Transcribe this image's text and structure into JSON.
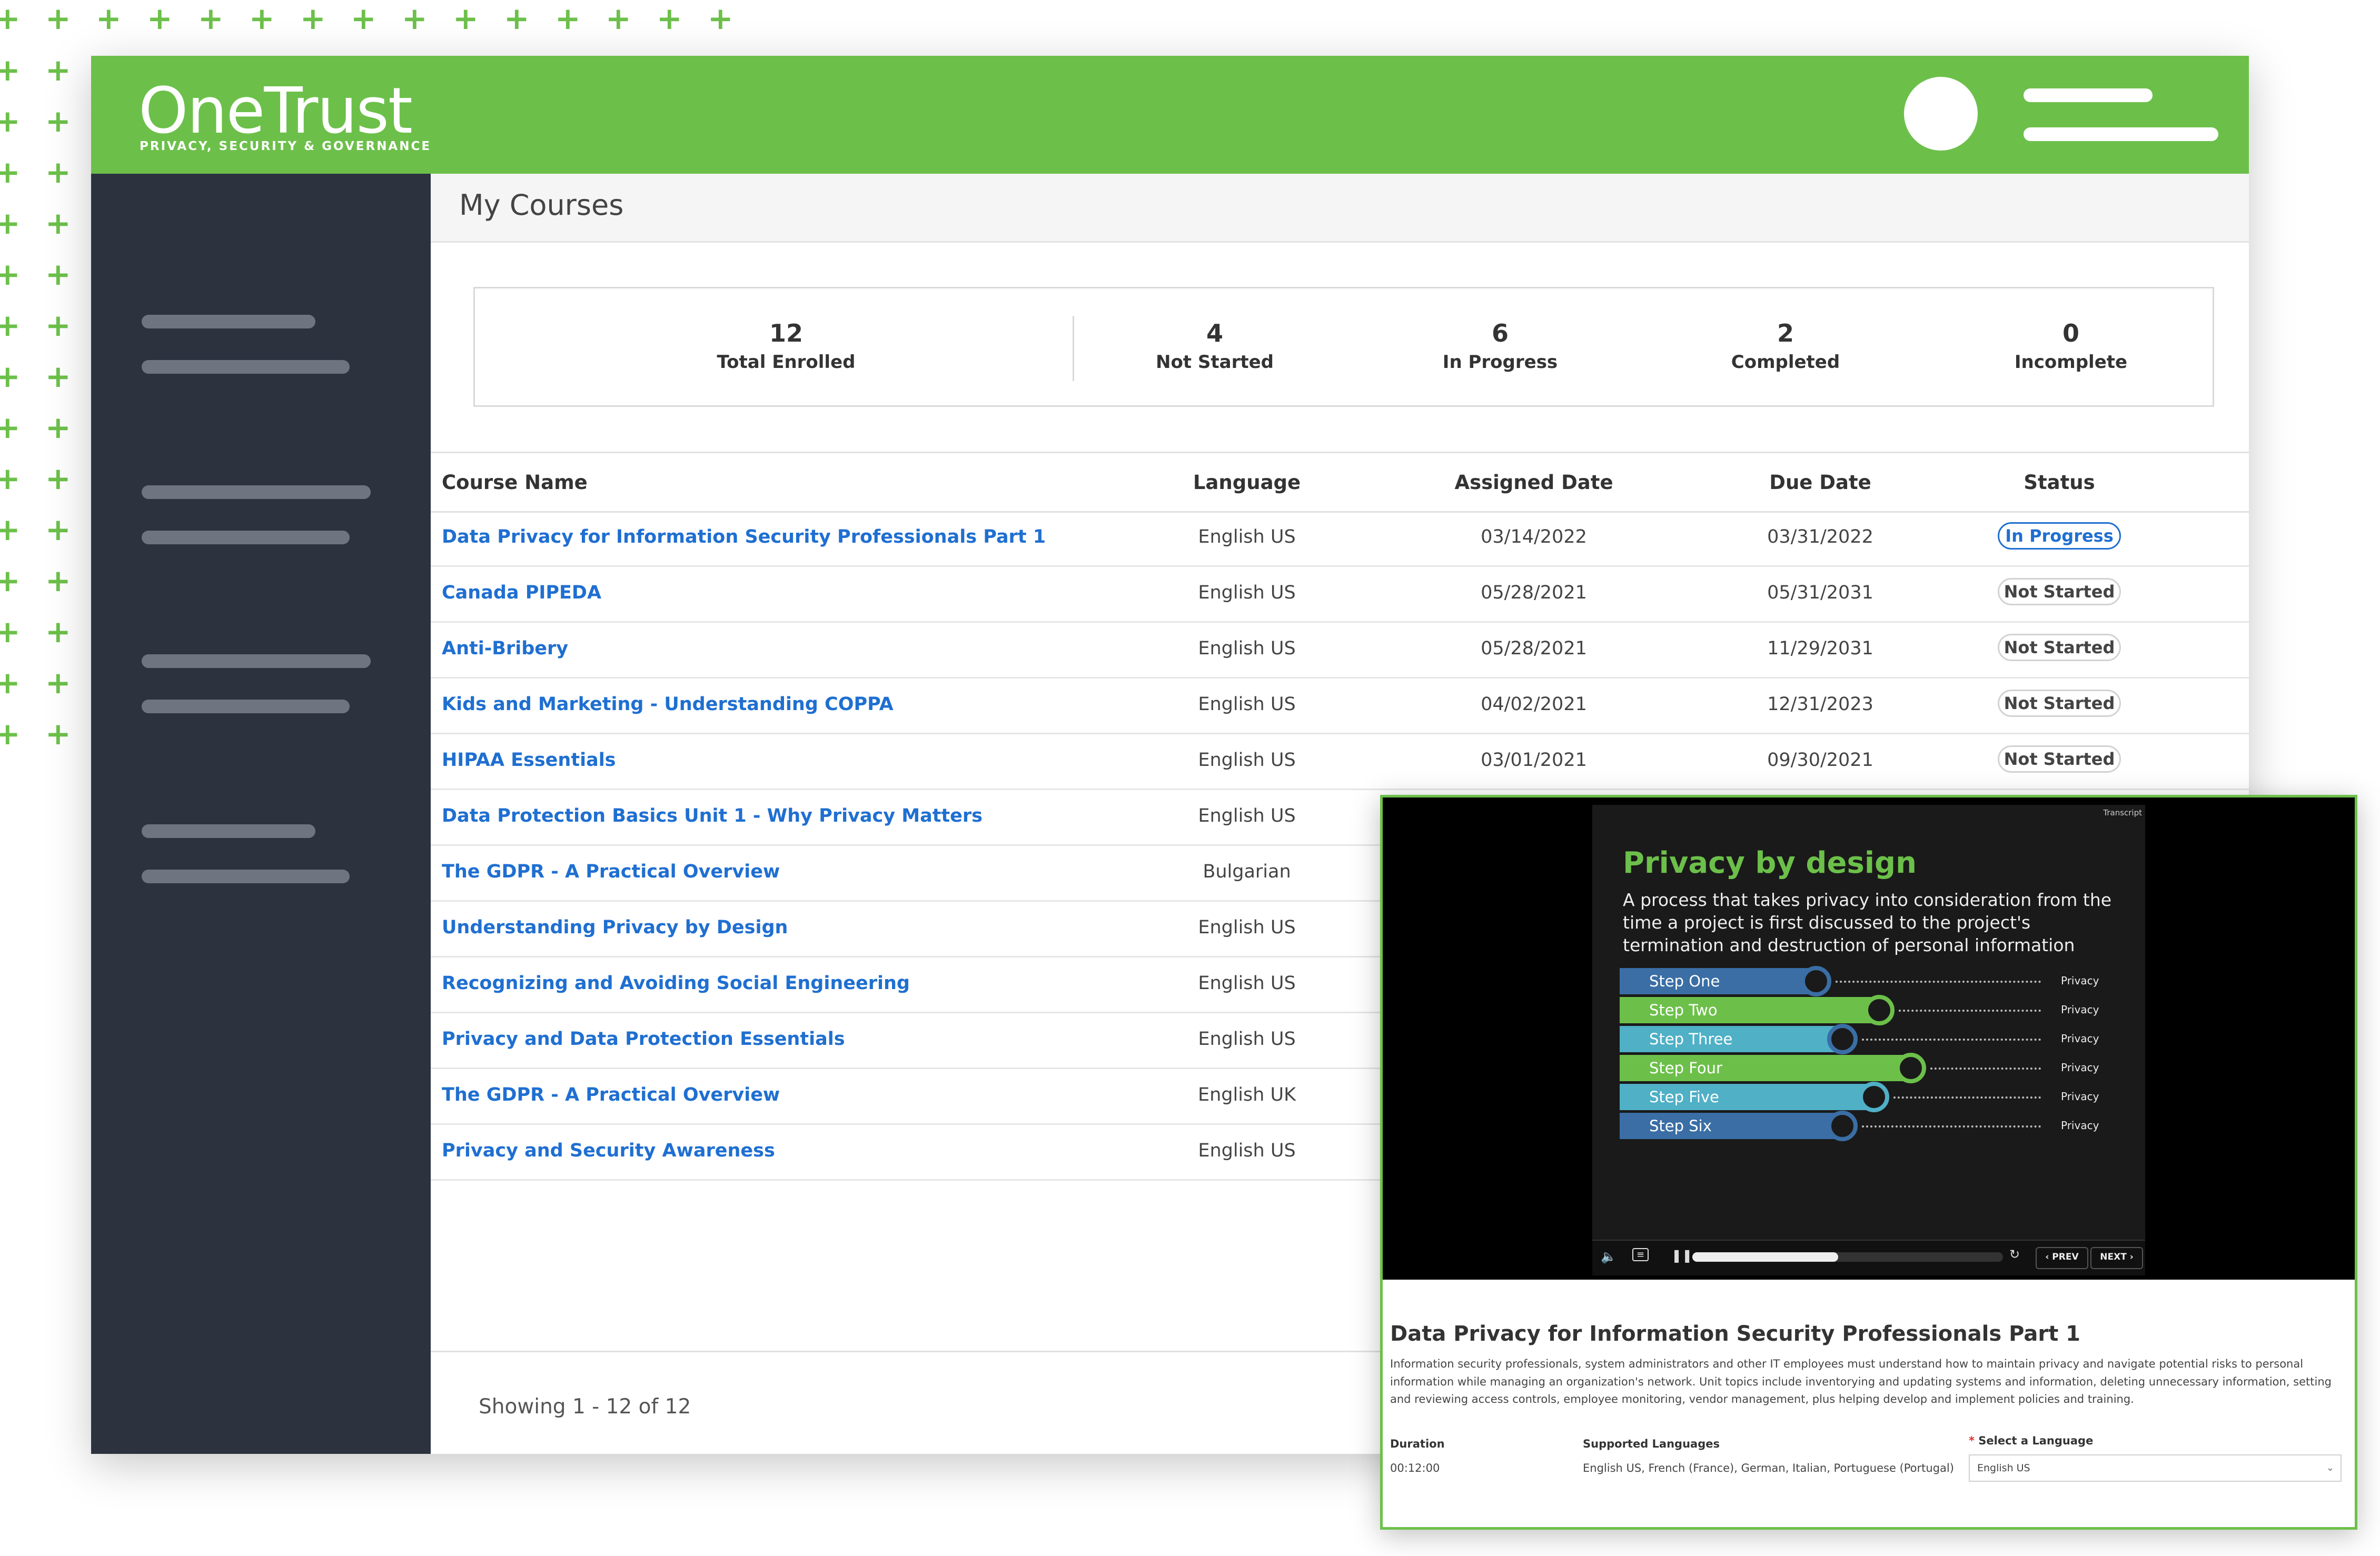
{
  "brand": {
    "name": "OneTrust",
    "tagline": "PRIVACY, SECURITY & GOVERNANCE",
    "accent": "#6cc04a",
    "sidebar_bg": "#2c333f",
    "link_color": "#1f6fd1"
  },
  "page": {
    "title": "My Courses"
  },
  "stats": [
    {
      "value": "12",
      "label": "Total Enrolled"
    },
    {
      "value": "4",
      "label": "Not Started"
    },
    {
      "value": "6",
      "label": "In Progress"
    },
    {
      "value": "2",
      "label": "Completed"
    },
    {
      "value": "0",
      "label": "Incomplete"
    }
  ],
  "table": {
    "headers": [
      "Course Name",
      "Language",
      "Assigned Date",
      "Due Date",
      "Status"
    ],
    "rows": [
      {
        "course": "Data Privacy for Information Security Professionals Part 1",
        "language": "English US",
        "assigned": "03/14/2022",
        "due": "03/31/2022",
        "status": "In Progress"
      },
      {
        "course": "Canada PIPEDA",
        "language": "English US",
        "assigned": "05/28/2021",
        "due": "05/31/2031",
        "status": "Not Started"
      },
      {
        "course": "Anti-Bribery",
        "language": "English US",
        "assigned": "05/28/2021",
        "due": "11/29/2031",
        "status": "Not Started"
      },
      {
        "course": "Kids and Marketing - Understanding COPPA",
        "language": "English US",
        "assigned": "04/02/2021",
        "due": "12/31/2023",
        "status": "Not Started"
      },
      {
        "course": "HIPAA Essentials",
        "language": "English US",
        "assigned": "03/01/2021",
        "due": "09/30/2021",
        "status": "Not Started"
      },
      {
        "course": "Data Protection Basics Unit 1 - Why Privacy Matters",
        "language": "English US"
      },
      {
        "course": "The GDPR - A Practical Overview",
        "language": "Bulgarian"
      },
      {
        "course": "Understanding Privacy by Design",
        "language": "English US"
      },
      {
        "course": "Recognizing and Avoiding Social Engineering",
        "language": "English US"
      },
      {
        "course": "Privacy and Data Protection Essentials",
        "language": "English US"
      },
      {
        "course": "The GDPR - A Practical Overview",
        "language": "English UK"
      },
      {
        "course": "Privacy and Security Awareness",
        "language": "English US"
      }
    ]
  },
  "pagination": {
    "showing": "Showing 1 - 12 of 12"
  },
  "preview": {
    "video": {
      "transcript_label": "Transcript",
      "slide_title": "Privacy by design",
      "slide_text": "A process that takes privacy into consideration from the time a project is first discussed to the project's termination and destruction of personal information",
      "steps": [
        {
          "label": "Step One",
          "tag": "Privacy"
        },
        {
          "label": "Step Two",
          "tag": "Privacy"
        },
        {
          "label": "Step Three",
          "tag": "Privacy"
        },
        {
          "label": "Step Four",
          "tag": "Privacy"
        },
        {
          "label": "Step Five",
          "tag": "Privacy"
        },
        {
          "label": "Step Six",
          "tag": "Privacy"
        }
      ],
      "progress": 0.47,
      "prev_label": "‹ PREV",
      "next_label": "NEXT ›"
    },
    "course_title": "Data Privacy for Information Security Professionals Part 1",
    "description": "Information security professionals, system administrators and other IT employees must understand how to maintain privacy and navigate potential risks to personal information while managing an organization's network. Unit topics include inventorying and updating systems and information, deleting unnecessary information, setting and reviewing access controls, employee monitoring, vendor management, plus helping develop and implement policies and training.",
    "duration_label": "Duration",
    "duration": "00:12:00",
    "languages_label": "Supported Languages",
    "languages": "English US, French (France), German, Italian, Portuguese (Portugal)",
    "select_label": "Select a Language",
    "select_required": "*",
    "selected_language": "English US"
  }
}
